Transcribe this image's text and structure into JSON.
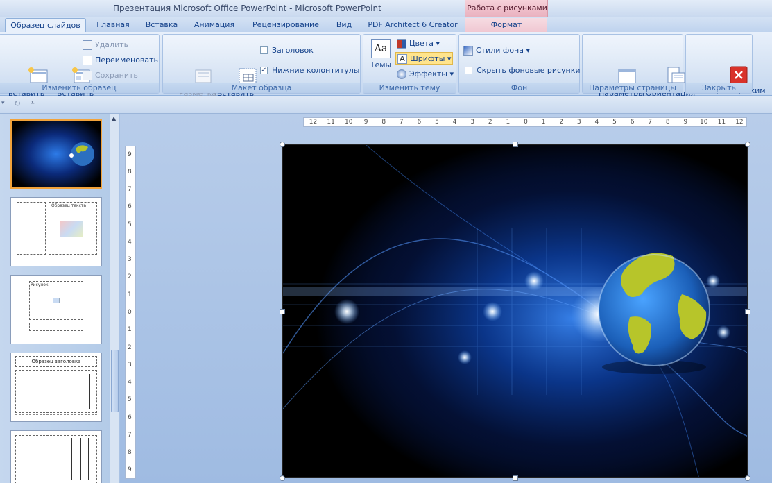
{
  "window": {
    "title": "Презентация Microsoft Office PowerPoint - Microsoft PowerPoint",
    "context_group": "Работа с рисунками"
  },
  "tabs": [
    {
      "label": "Образец слайдов"
    },
    {
      "label": "Главная"
    },
    {
      "label": "Вставка"
    },
    {
      "label": "Анимация"
    },
    {
      "label": "Рецензирование"
    },
    {
      "label": "Вид"
    },
    {
      "label": "PDF Architect 6 Creator"
    },
    {
      "label": "Формат"
    }
  ],
  "ribbon": {
    "edit_master": {
      "label": "Изменить образец",
      "insert_slide_master": "вставить\nвец слайдов",
      "insert_layout": "Вставить\nмакет",
      "delete": "Удалить",
      "rename": "Переименовать",
      "preserve": "Сохранить"
    },
    "master_layout": {
      "label": "Макет образца",
      "master_layout_btn": "Разметка\nобразца",
      "insert_placeholder": "Вставить\nзаполнитель",
      "title_cb": "Заголовок",
      "footers_cb": "Нижние колонтитулы"
    },
    "edit_theme": {
      "label": "Изменить тему",
      "themes": "Темы",
      "colors": "Цвета",
      "fonts": "Шрифты",
      "effects": "Эффекты"
    },
    "background": {
      "label": "Фон",
      "bg_styles": "Стили фона",
      "hide_bg": "Скрыть фоновые рисунки"
    },
    "page_setup": {
      "label": "Параметры страницы",
      "page_setup_btn": "Параметры\nстраницы",
      "orientation": "Ориентация\nслайда"
    },
    "close": {
      "label": "Закрыть",
      "close_master": "Закрыть режим\nобразца"
    }
  },
  "thumbnails": [
    {
      "text": ""
    },
    {
      "text": "Образец текста"
    },
    {
      "text": "Рисунок"
    },
    {
      "text": "Образец заголовка"
    },
    {
      "text": ""
    }
  ],
  "ruler": {
    "h_ticks": [
      "12",
      "11",
      "10",
      "9",
      "8",
      "7",
      "6",
      "5",
      "4",
      "3",
      "2",
      "1",
      "0",
      "1",
      "2",
      "3",
      "4",
      "5",
      "6",
      "7",
      "8",
      "9",
      "10",
      "11",
      "12"
    ],
    "v_ticks": [
      "9",
      "8",
      "7",
      "6",
      "5",
      "4",
      "3",
      "2",
      "1",
      "0",
      "1",
      "2",
      "3",
      "4",
      "5",
      "6",
      "7",
      "8",
      "9"
    ]
  },
  "colors": {
    "accent": "#15428b",
    "selected_thumb": "#f2a33a",
    "close_icon": "#d9322a"
  }
}
